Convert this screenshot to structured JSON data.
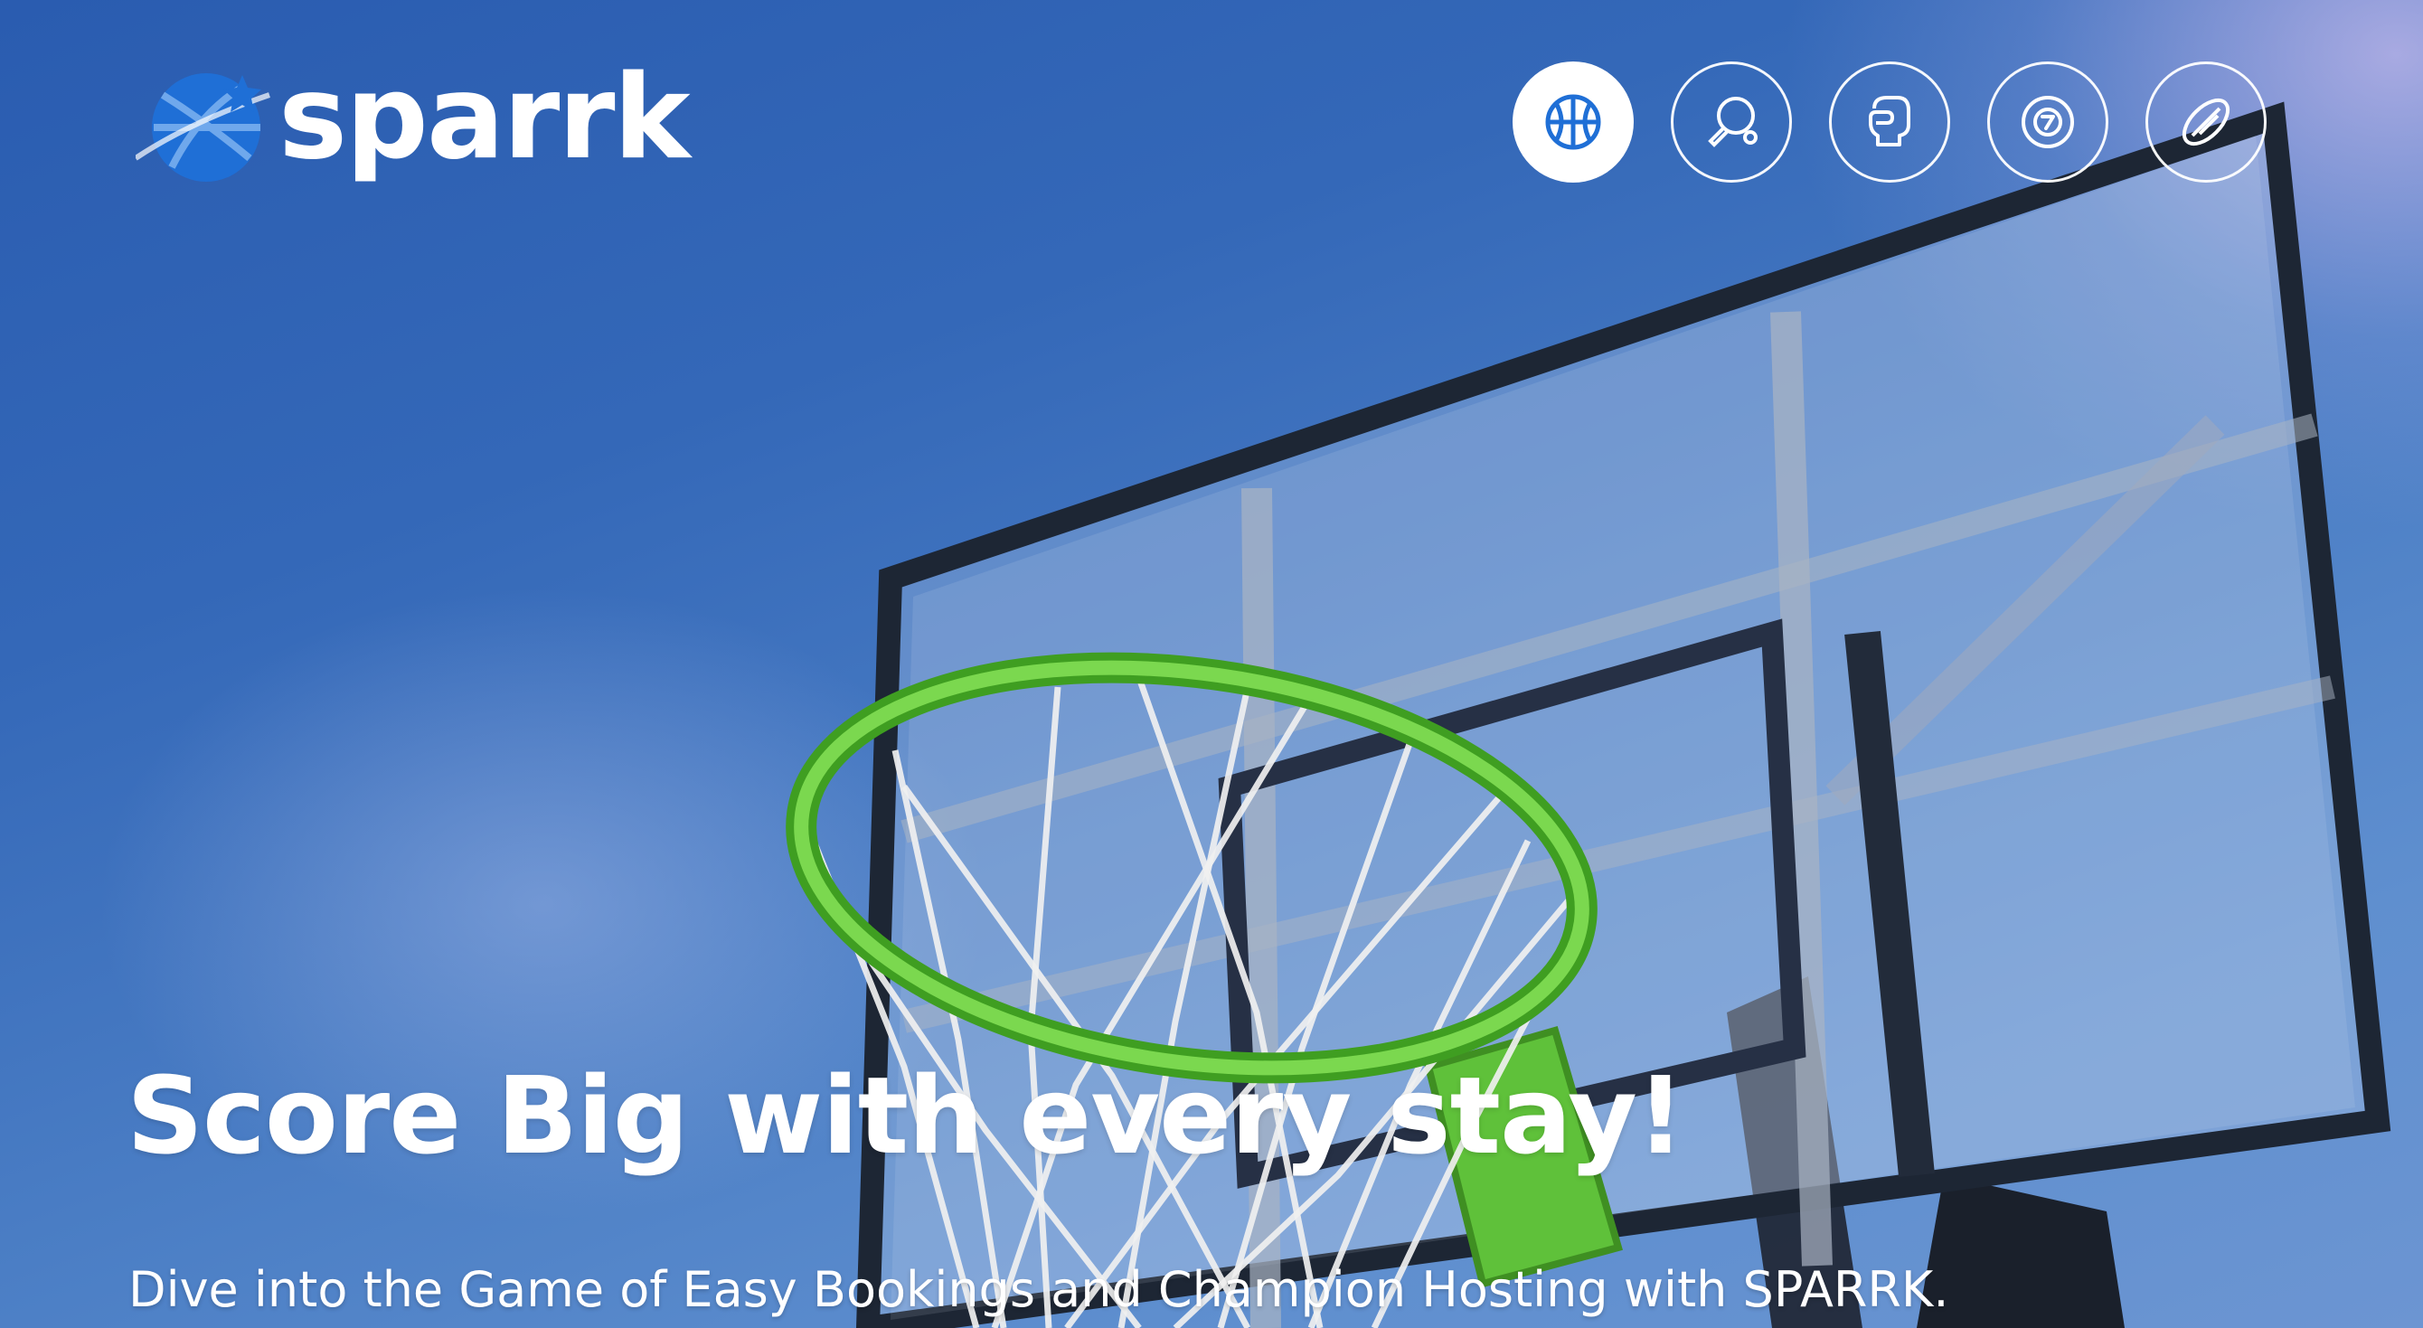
{
  "brand": {
    "name": "sparrk",
    "logo_icon": "basketball-swoosh-logo",
    "accent_color": "#1f6fd6"
  },
  "sport_nav": {
    "items": [
      {
        "icon": "basketball-icon",
        "active": true
      },
      {
        "icon": "table-tennis-icon",
        "active": false
      },
      {
        "icon": "boxing-glove-icon",
        "active": false
      },
      {
        "icon": "billiard-ball-icon",
        "active": false
      },
      {
        "icon": "rugby-ball-icon",
        "active": false
      }
    ]
  },
  "hero": {
    "headline": "Score Big with every stay!",
    "subheadline": "Dive into the Game of Easy Bookings and Champion Hosting with SPARRK.",
    "background": "basketball-hoop-photo"
  }
}
